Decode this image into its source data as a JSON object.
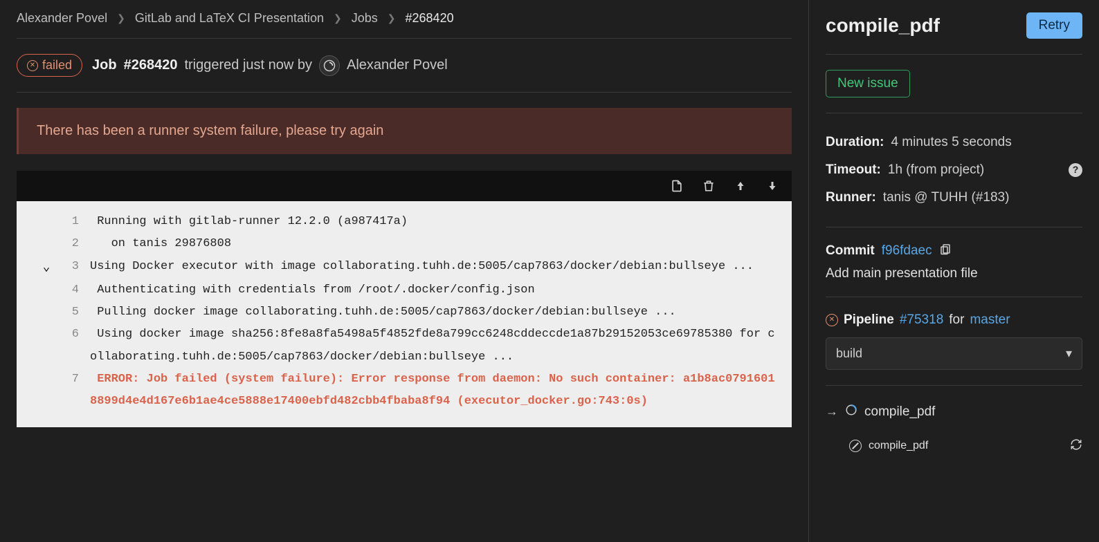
{
  "breadcrumbs": {
    "owner": "Alexander Povel",
    "project": "GitLab and LaTeX CI Presentation",
    "jobs_label": "Jobs",
    "job_id": "#268420"
  },
  "status": {
    "label": "failed"
  },
  "job_header": {
    "prefix": "Job",
    "id": "#268420",
    "triggered_text": "triggered just now by",
    "user": "Alexander Povel"
  },
  "alert": {
    "message": "There has been a runner system failure, please try again"
  },
  "log": {
    "toolbar": {
      "raw": "raw-log",
      "erase": "erase-log",
      "scroll_top": "scroll-top",
      "scroll_bottom": "scroll-bottom"
    },
    "lines": [
      {
        "n": 1,
        "fold": false,
        "text": " Running with gitlab-runner 12.2.0 (a987417a)",
        "err": false
      },
      {
        "n": 2,
        "fold": false,
        "text": "   on tanis 29876808",
        "err": false
      },
      {
        "n": 3,
        "fold": true,
        "text": "Using Docker executor with image collaborating.tuhh.de:5005/cap7863/docker/debian:bullseye ...",
        "err": false
      },
      {
        "n": 4,
        "fold": false,
        "text": " Authenticating with credentials from /root/.docker/config.json",
        "err": false
      },
      {
        "n": 5,
        "fold": false,
        "text": " Pulling docker image collaborating.tuhh.de:5005/cap7863/docker/debian:bullseye ...",
        "err": false
      },
      {
        "n": 6,
        "fold": false,
        "text": " Using docker image sha256:8fe8a8fa5498a5f4852fde8a799cc6248cddeccde1a87b29152053ce69785380 for collaborating.tuhh.de:5005/cap7863/docker/debian:bullseye ...",
        "err": false
      },
      {
        "n": 7,
        "fold": false,
        "text": " ERROR: Job failed (system failure): Error response from daemon: No such container: a1b8ac07916018899d4e4d167e6b1ae4ce5888e17400ebfd482cbb4fbaba8f94 (executor_docker.go:743:0s)",
        "err": true
      }
    ]
  },
  "sidebar": {
    "title": "compile_pdf",
    "retry": "Retry",
    "new_issue": "New issue",
    "duration_label": "Duration:",
    "duration_value": "4 minutes 5 seconds",
    "timeout_label": "Timeout:",
    "timeout_value": "1h (from project)",
    "runner_label": "Runner:",
    "runner_value": "tanis @ TUHH (#183)",
    "commit_label": "Commit",
    "commit_sha": "f96fdaec",
    "commit_message": "Add main presentation file",
    "pipeline_label": "Pipeline",
    "pipeline_id": "#75318",
    "pipeline_for": "for",
    "pipeline_branch": "master",
    "stage": "build",
    "active_job": "compile_pdf",
    "sub_job": "compile_pdf"
  }
}
